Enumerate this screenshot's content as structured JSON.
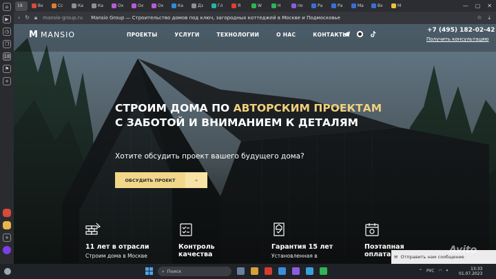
{
  "browser": {
    "tabs": [
      {
        "label": "18",
        "active": true,
        "color": "#8a8d93"
      },
      {
        "label": "Вх",
        "color": "#d64b3b"
      },
      {
        "label": "Cс",
        "color": "#e07b39"
      },
      {
        "label": "Ка",
        "color": "#8d8f94"
      },
      {
        "label": "Ка",
        "color": "#8d8f94"
      },
      {
        "label": "Ох",
        "color": "#b85cd6"
      },
      {
        "label": "Ох",
        "color": "#b85cd6"
      },
      {
        "label": "Ох",
        "color": "#b85cd6"
      },
      {
        "label": "Ка",
        "color": "#2f8ad8"
      },
      {
        "label": "Дз",
        "color": "#8d8f94"
      },
      {
        "label": "Гл",
        "color": "#24b3a6"
      },
      {
        "label": "Я",
        "color": "#e0402f"
      },
      {
        "label": "W",
        "color": "#2fb356"
      },
      {
        "label": "Н",
        "color": "#2fb356"
      },
      {
        "label": "по",
        "color": "#8d5cd6"
      },
      {
        "label": "Ра",
        "color": "#3b6fd6"
      },
      {
        "label": "Ра",
        "color": "#3b6fd6"
      },
      {
        "label": "Ма",
        "color": "#3b6fd6"
      },
      {
        "label": "Вх",
        "color": "#3b6fd6"
      },
      {
        "label": "М",
        "color": "#f0c23a"
      }
    ],
    "url": "mansio-group.ru",
    "page_title": "Mansio Group — Строительство домов под ключ, загородных коттеджей в Москве и Подмосковье"
  },
  "site": {
    "logo_text": "MANSIO",
    "nav": [
      "ПРОЕКТЫ",
      "УСЛУГИ",
      "ТЕХНОЛОГИИ",
      "О НАС",
      "КОНТАКТЫ"
    ],
    "phone": "+7 (495) 182-02-42",
    "consult_link": "Получить консультацию",
    "hero": {
      "title_before": "СТРОИМ ДОМА ПО ",
      "title_accent": "АВТОРСКИМ ПРОЕКТАМ",
      "title_after": " С ЗАБОТОЙ И ВНИМАНИЕМ К ДЕТАЛЯМ",
      "subtitle": "Хотите обсудить проект вашего будущего дома?",
      "cta_label": "ОБСУДИТЬ ПРОЕКТ",
      "cta_arrow": "»"
    },
    "features": [
      {
        "title": "11 лет в отрасли",
        "desc": "Строим дома в Москве",
        "icon": "bricks-icon"
      },
      {
        "title": "Контроль качества",
        "desc": "",
        "icon": "checklist-icon"
      },
      {
        "title": "Гарантия 15 лет",
        "desc": "Установленная в",
        "icon": "guarantee-icon"
      },
      {
        "title": "Поэтапная оплата",
        "desc": "",
        "icon": "calendar-icon"
      }
    ],
    "notification": "Отправить нам сообщение",
    "watermark": "Avito"
  },
  "taskbar": {
    "search_placeholder": "Поиск",
    "lang": "РУС",
    "time": "13:33",
    "date": "01.07.2023"
  },
  "colors": {
    "accent_gold": "#f1d07b",
    "cta": "#f2d78a"
  }
}
